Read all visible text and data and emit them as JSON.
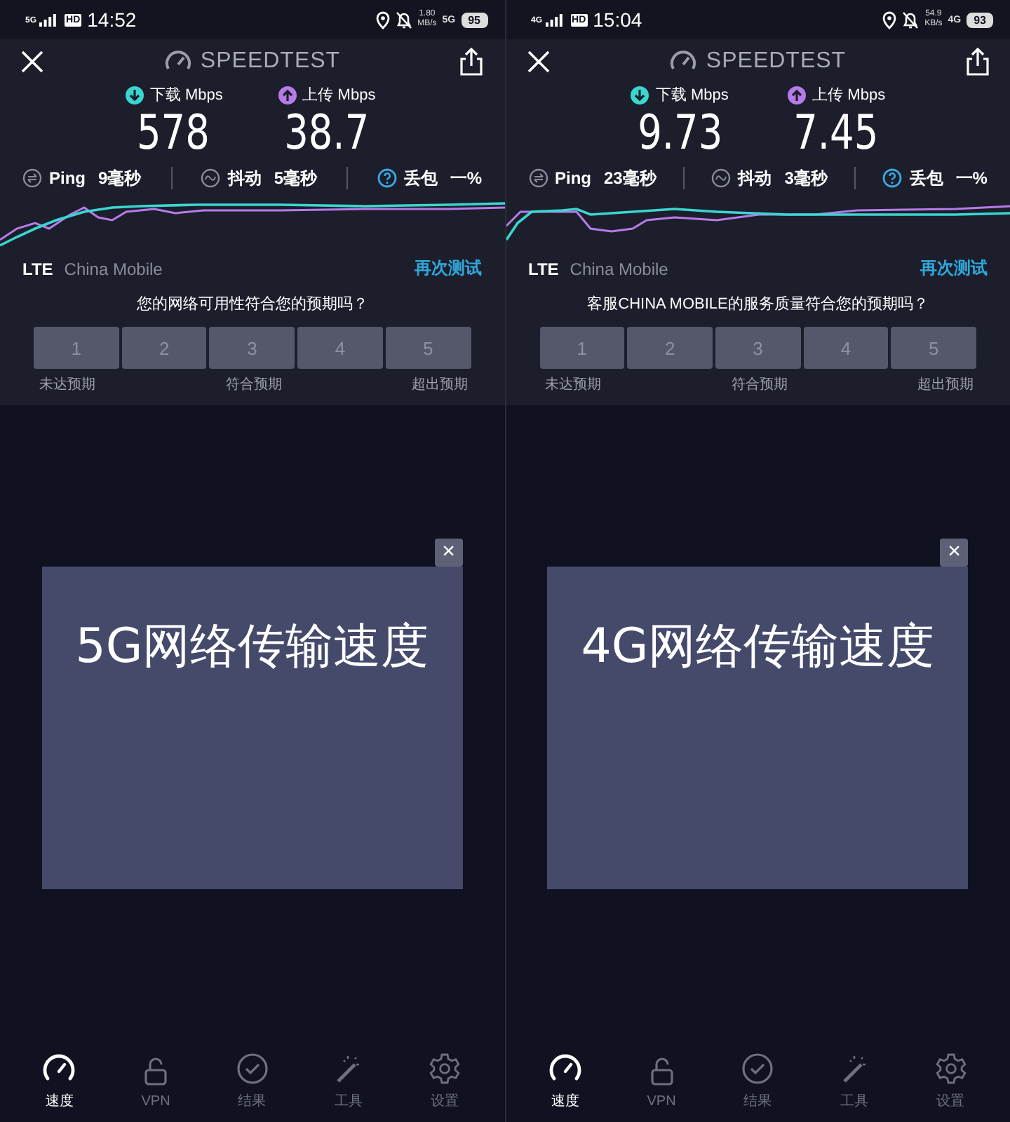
{
  "screens": [
    {
      "status_bar": {
        "network": "5G",
        "time": "14:52",
        "hd": "HD",
        "speed_value": "1.80",
        "speed_unit": "MB/s",
        "data_network": "5G",
        "battery": "95"
      },
      "app_title": "SPEEDTEST",
      "metrics": [
        {
          "label": "下载 Mbps",
          "value": "578",
          "color": "#3ad6d0"
        },
        {
          "label": "上传 Mbps",
          "value": "38.7",
          "color": "#b77be8"
        }
      ],
      "stats": [
        {
          "label": "Ping",
          "value": "9毫秒"
        },
        {
          "label": "抖动",
          "value": "5毫秒"
        },
        {
          "label": "丢包",
          "value": "一%"
        }
      ],
      "network_type": "LTE",
      "carrier": "China Mobile",
      "retest": "再次测试",
      "question": "您的网络可用性符合您的预期吗？",
      "ratings": [
        "1",
        "2",
        "3",
        "4",
        "5"
      ],
      "scale_labels": [
        "未达预期",
        "符合预期",
        "超出预期"
      ],
      "overlay": {
        "caption": "5G网络传输速度",
        "close": "×"
      },
      "nav": [
        {
          "label": "速度",
          "selected": true
        },
        {
          "label": "VPN",
          "selected": false
        },
        {
          "label": "结果",
          "selected": false
        },
        {
          "label": "工具",
          "selected": false
        },
        {
          "label": "设置",
          "selected": false
        }
      ]
    },
    {
      "status_bar": {
        "network": "4G",
        "time": "15:04",
        "hd": "HD",
        "speed_value": "54.9",
        "speed_unit": "KB/s",
        "data_network": "4G",
        "battery": "93"
      },
      "app_title": "SPEEDTEST",
      "metrics": [
        {
          "label": "下载 Mbps",
          "value": "9.73",
          "color": "#3ad6d0"
        },
        {
          "label": "上传 Mbps",
          "value": "7.45",
          "color": "#b77be8"
        }
      ],
      "stats": [
        {
          "label": "Ping",
          "value": "23毫秒"
        },
        {
          "label": "抖动",
          "value": "3毫秒"
        },
        {
          "label": "丢包",
          "value": "一%"
        }
      ],
      "network_type": "LTE",
      "carrier": "China Mobile",
      "retest": "再次测试",
      "question": "客服CHINA MOBILE的服务质量符合您的预期吗？",
      "ratings": [
        "1",
        "2",
        "3",
        "4",
        "5"
      ],
      "scale_labels": [
        "未达预期",
        "符合预期",
        "超出预期"
      ],
      "overlay": {
        "caption": "4G网络传输速度",
        "close": "×"
      },
      "nav": [
        {
          "label": "速度",
          "selected": true
        },
        {
          "label": "VPN",
          "selected": false
        },
        {
          "label": "结果",
          "selected": false
        },
        {
          "label": "工具",
          "selected": false
        },
        {
          "label": "设置",
          "selected": false
        }
      ]
    }
  ]
}
